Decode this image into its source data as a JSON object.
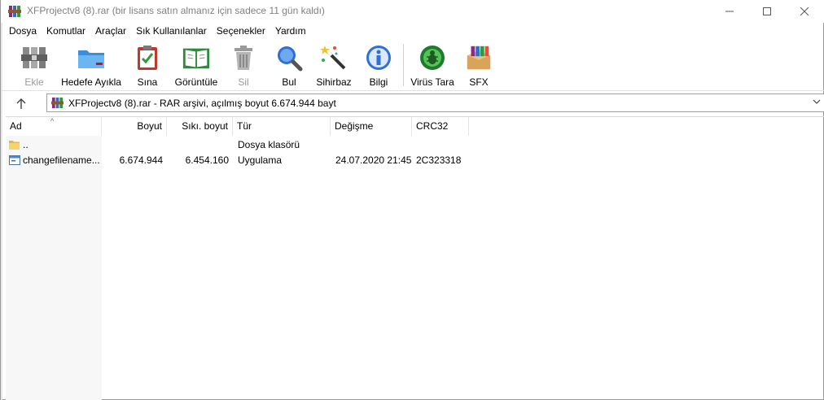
{
  "window": {
    "title": "XFProjectv8 (8).rar (bir lisans satın almanız için sadece 11 gün kaldı)"
  },
  "menu": [
    "Dosya",
    "Komutlar",
    "Araçlar",
    "Sık Kullanılanlar",
    "Seçenekler",
    "Yardım"
  ],
  "toolbar": {
    "add": "Ekle",
    "extract": "Hedefe Ayıkla",
    "test": "Sına",
    "view": "Görüntüle",
    "delete": "Sil",
    "find": "Bul",
    "wizard": "Sihirbaz",
    "info": "Bilgi",
    "virus": "Virüs Tara",
    "sfx": "SFX"
  },
  "address": {
    "text": "XFProjectv8 (8).rar - RAR arşivi, açılmış boyut 6.674.944 bayt"
  },
  "columns": {
    "name": "Ad",
    "size": "Boyut",
    "packed": "Sıkı. boyut",
    "type": "Tür",
    "modified": "Değişme",
    "crc": "CRC32"
  },
  "rows": [
    {
      "name": "..",
      "size": "",
      "packed": "",
      "type": "Dosya klasörü",
      "modified": "",
      "crc": "",
      "icon": "folder-icon"
    },
    {
      "name": "changefilename...",
      "size": "6.674.944",
      "packed": "6.454.160",
      "type": "Uygulama",
      "modified": "24.07.2020 21:45",
      "crc": "2C323318",
      "icon": "application-icon"
    }
  ]
}
